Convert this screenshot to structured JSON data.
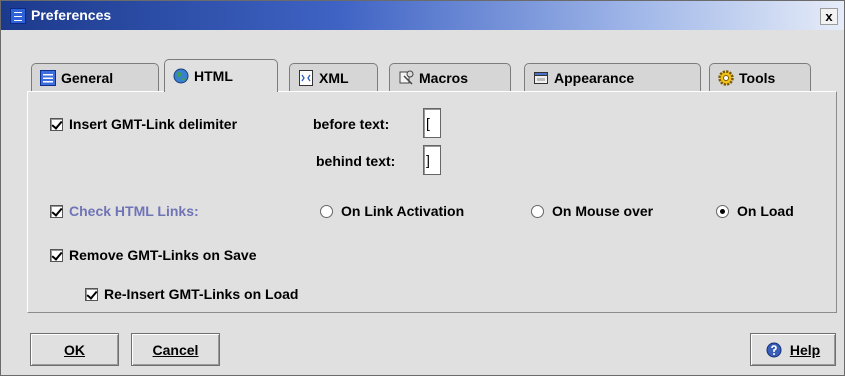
{
  "window": {
    "title": "Preferences",
    "close_label": "x"
  },
  "tabs": [
    {
      "label": "General",
      "icon": "list-icon",
      "active": false
    },
    {
      "label": "HTML",
      "icon": "globe-icon",
      "active": true
    },
    {
      "label": "XML",
      "icon": "xml-document-icon",
      "active": false
    },
    {
      "label": "Macros",
      "icon": "macro-icon",
      "active": false
    },
    {
      "label": "Appearance",
      "icon": "appearance-icon",
      "active": false
    },
    {
      "label": "Tools",
      "icon": "gear-icon",
      "active": false
    }
  ],
  "html_tab": {
    "insert_delimiter_label": "Insert GMT-Link delimiter",
    "insert_delimiter_checked": true,
    "before_text_label": "before text:",
    "before_text_value": "[",
    "behind_text_label": "behind text:",
    "behind_text_value": "]",
    "check_links_label": "Check HTML Links:",
    "check_links_checked": true,
    "radio_options": [
      {
        "label": "On Link Activation",
        "selected": false
      },
      {
        "label": "On Mouse over",
        "selected": false
      },
      {
        "label": "On Load",
        "selected": true
      }
    ],
    "remove_links_label": "Remove GMT-Links on Save",
    "remove_links_checked": true,
    "reinsert_links_label": "Re-Insert GMT-Links on Load",
    "reinsert_links_checked": true
  },
  "buttons": {
    "ok_label": "OK",
    "cancel_label": "Cancel",
    "help_label": "Help"
  },
  "colors": {
    "titlebar_start": "#1c3a8c",
    "titlebar_end": "#e6ecf8",
    "disabled_label": "#6f74b6",
    "panel_background": "#e0e0e0"
  }
}
